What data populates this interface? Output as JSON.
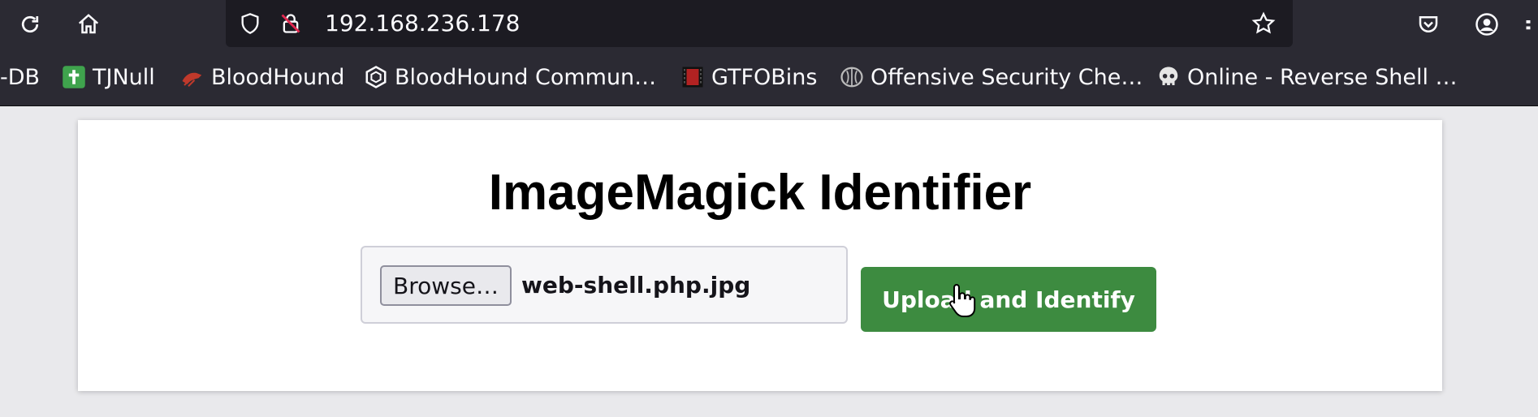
{
  "browser": {
    "url": "192.168.236.178",
    "bookmarks": [
      {
        "label": "-DB",
        "icon": "none"
      },
      {
        "label": "TJNull",
        "icon": "green-plus-icon"
      },
      {
        "label": "BloodHound",
        "icon": "bloodhound-icon"
      },
      {
        "label": "BloodHound Commun…",
        "icon": "hexagon-icon"
      },
      {
        "label": "GTFOBins",
        "icon": "gtfobins-icon"
      },
      {
        "label": "Offensive Security Che…",
        "icon": "brain-icon"
      },
      {
        "label": "Online - Reverse Shell …",
        "icon": "skull-icon"
      }
    ]
  },
  "page": {
    "title": "ImageMagick Identifier",
    "file_input": {
      "browse_label": "Browse…",
      "file_name": "web-shell.php.jpg"
    },
    "submit_label": "Upload and Identify"
  },
  "colors": {
    "toolbar": "#2b2a33",
    "urlbar": "#1c1b22",
    "page_bg": "#e9e9ec",
    "button_green": "#3d8b40"
  }
}
